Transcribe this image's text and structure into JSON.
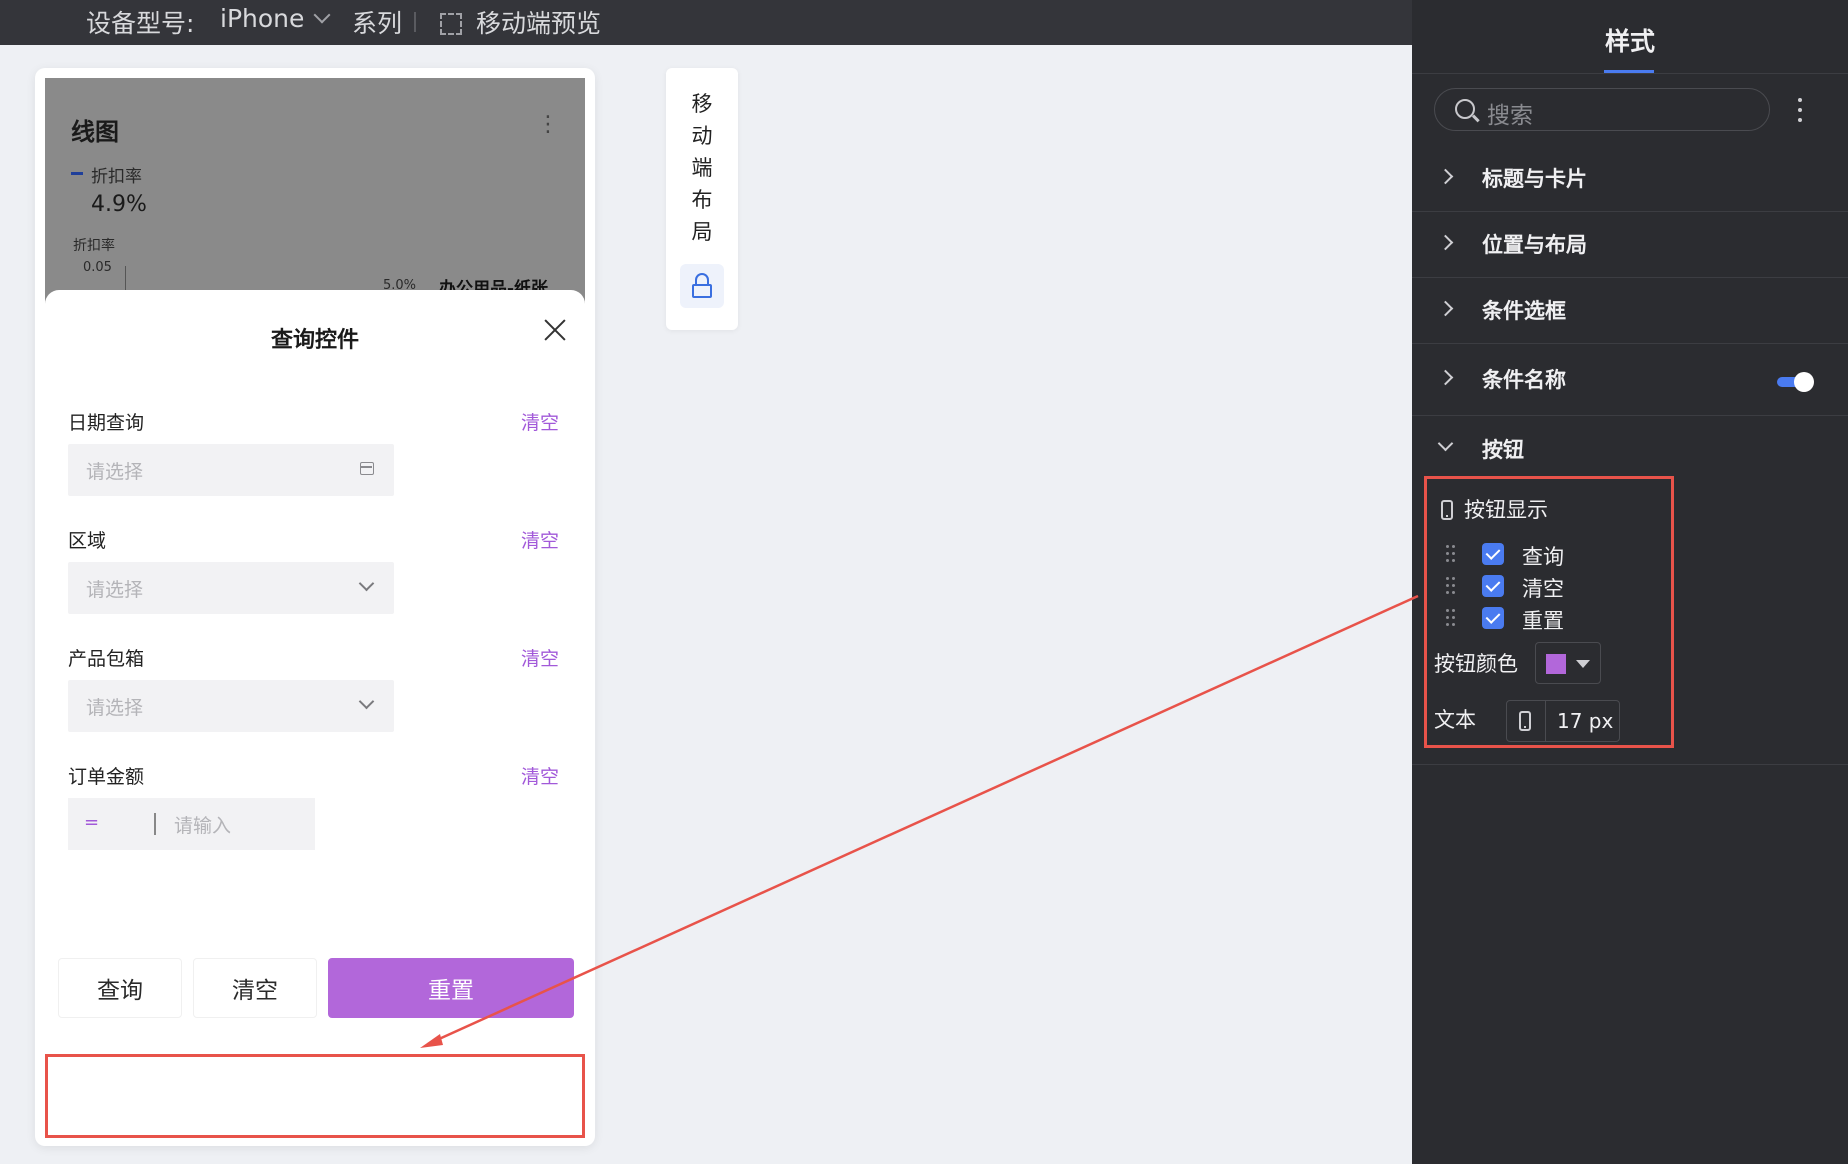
{
  "topbar": {
    "device_label": "设备型号:",
    "device_value": "iPhone",
    "series_label": "系列",
    "preview_label": "移动端预览"
  },
  "chart": {
    "title": "线图",
    "legend": "折扣率",
    "kpi": "4.9%",
    "axis_label": "折扣率",
    "tick": "0.05",
    "data_label": "5.0%",
    "category_label": "办公用品-纸张"
  },
  "chart_data": {
    "type": "line",
    "title": "线图",
    "ylabel": "折扣率",
    "series": [
      {
        "name": "折扣率",
        "values": [
          0.05
        ]
      }
    ],
    "categories": [
      "办公用品-纸张"
    ],
    "yticks": [
      "0.05"
    ]
  },
  "query": {
    "title": "查询控件",
    "clear_label": "清空",
    "fields": [
      {
        "label": "日期查询",
        "placeholder": "请选择"
      },
      {
        "label": "区域",
        "placeholder": "请选择"
      },
      {
        "label": "产品包箱",
        "placeholder": "请选择"
      },
      {
        "label": "订单金额",
        "operator": "=",
        "placeholder": "请输入"
      }
    ],
    "buttons": {
      "query": "查询",
      "clear": "清空",
      "reset": "重置"
    }
  },
  "layout_panel": {
    "text": "移\n动\n端\n布\n局"
  },
  "side": {
    "tab": "样式",
    "search_placeholder": "搜索",
    "sections": [
      "标题与卡片",
      "位置与布局",
      "条件选框",
      "条件名称",
      "按钮"
    ],
    "button_display": {
      "title": "按钮显示",
      "items": [
        "查询",
        "清空",
        "重置"
      ]
    },
    "button_color_label": "按钮颜色",
    "button_color": "#b267da",
    "text_label": "文本",
    "text_size": "17 px"
  },
  "colors": {
    "accent": "#a259d9",
    "primary_button": "#b267da",
    "highlight": "#e8534a",
    "toggle": "#4a7bf0"
  }
}
